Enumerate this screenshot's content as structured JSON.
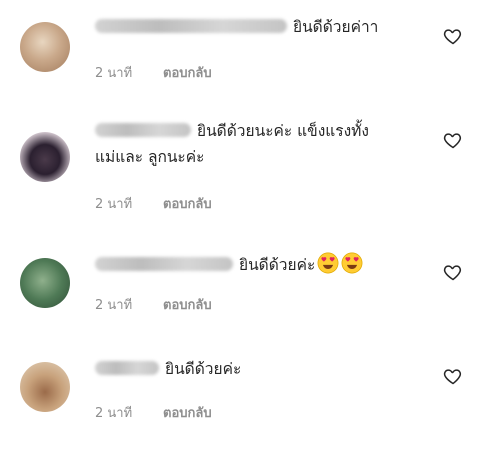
{
  "comments": [
    {
      "text": "ยินดีด้วยค่าา",
      "time": "2 นาที",
      "reply_label": "ตอบกลับ"
    },
    {
      "text": "ยินดีด้วยนะค่ะ แข็งแรงทั้ง",
      "text_line2": "แม่และ ลูกนะค่ะ",
      "time": "2 นาที",
      "reply_label": "ตอบกลับ"
    },
    {
      "text": "ยินดีด้วยค่ะ",
      "emojis": [
        "heart-eyes-emoji",
        "heart-eyes-emoji"
      ],
      "time": "2 นาที",
      "reply_label": "ตอบกลับ"
    },
    {
      "text": "ยินดีด้วยค่ะ",
      "time": "2 นาที",
      "reply_label": "ตอบกลับ"
    }
  ],
  "colors": {
    "text": "#262626",
    "meta": "#8e8e8e",
    "heart_outline": "#262626"
  },
  "icons": {
    "like": "heart-outline-icon"
  }
}
